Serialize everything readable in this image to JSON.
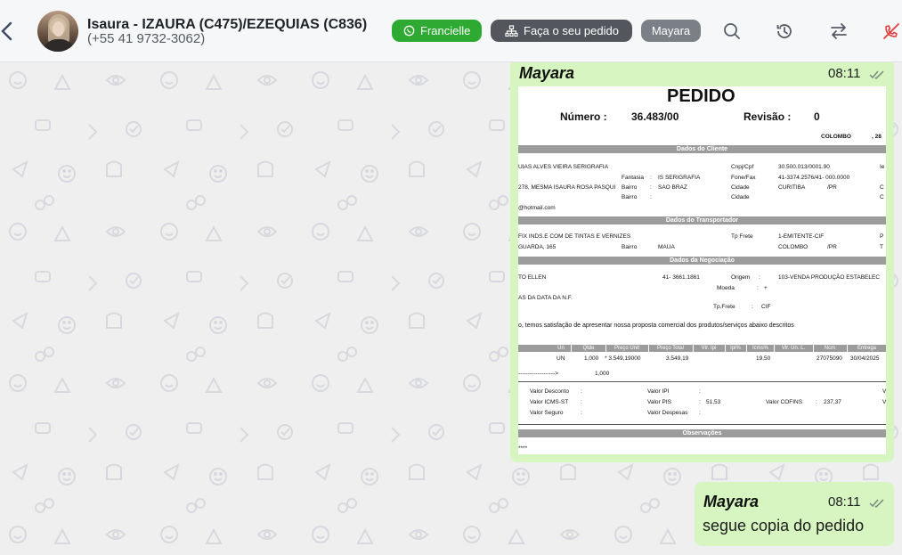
{
  "header": {
    "contact_name": "Isaura - IZAURA (C475)/EZEQUIAS (C836)",
    "contact_phone": "(+55 41 9732-3062)",
    "tags": [
      {
        "label": "Francielle",
        "icon": "whatsapp-icon",
        "color": "#2eaa33"
      },
      {
        "label": "Faça o seu pedido",
        "icon": "sitemap-icon",
        "color": "#53575d"
      },
      {
        "label": "Mayara",
        "color": "#7b8087"
      }
    ],
    "icons": [
      "back-chevron-icon",
      "search-icon",
      "history-icon",
      "transfer-icon",
      "close-chat-icon"
    ]
  },
  "messages": [
    {
      "sender": "Mayara",
      "time": "08:11",
      "type": "image",
      "document": {
        "title": "PEDIDO",
        "numero_label": "Número :",
        "numero_value": "36.483/00",
        "revisao_label": "Revisão :",
        "revisao_value": "0",
        "city_date": "COLOMBO",
        "city_date_suffix": ", 28",
        "section_cliente": "Dados do Cliente",
        "cliente_name": "UIAS ALVES VIEIRA SERIGRAFIA",
        "cnpj_label": "Cnpj/Cpf",
        "cnpj_value": "30.500.013/0001.90",
        "ie_label": "Ie",
        "fantasia_label": "Fantasia",
        "fantasia_value": "IS SERIGRAFIA",
        "fone_label": "Fone/Fax",
        "fone_value": "41-3374.2576/41- 000.0000",
        "address": "278, MESMA ISAURA ROSA PASQUI",
        "bairro_label": "Bairro",
        "bairro_value": "SAO BRAZ",
        "cidade_label": "Cidade",
        "cidade_value": "CURITIBA",
        "uf_value": "/PR",
        "c_label": "C",
        "email": "@hotmail.com",
        "section_transportador": "Dados do Transportador",
        "transp_name": "FIX INDS.E COM DE TINTAS E VERNIZES",
        "tp_frete_label": "Tp Frete",
        "tp_frete_value": "1-EMITENTE-CIF",
        "p_label": "P",
        "transp_address": "GUARDA, 165",
        "transp_bairro_value": "MAUA",
        "transp_cidade_value": "COLOMBO",
        "t_label": "T",
        "section_negociacao": "Dados da Negociação",
        "neg_contact": "TO ELLEN",
        "neg_phone": "41- 3661.1861",
        "origem_label": "Origem",
        "origem_value": "103-VENDA PRODUÇÃO ESTABELEC",
        "moeda_label": "Moeda",
        "moeda_value": "+",
        "prazo_text": "AS DA DATA DA N.F.",
        "tp_frete2_label": "Tp.Frete",
        "tp_frete2_value": "CIF",
        "proposal_text": "o, temos satisfação de apresentar nossa proposta comercial dos produtos/serviços abaixo descritos",
        "table_headers": [
          "Un",
          "Qtde",
          "Preço Unit",
          "Preço Total",
          "Vlr. Ipi",
          "Ipi%",
          "Icms%",
          "Vlr. Un. L.",
          "Ncm",
          "Entrega"
        ],
        "table_row": [
          "UN",
          "1,000",
          "* 3.549,19000",
          "3.549,19",
          "19,50",
          "27075090",
          "30/04/2025"
        ],
        "arrow_text": "------------------->",
        "total_qtde": "1,000",
        "valor_desconto_label": "Valor Desconto",
        "valor_ipi_label": "Valor IPI",
        "valor_icms_st_label": "Valor ICMS-ST",
        "valor_pis_label": "Valor PIS",
        "valor_pis_value": "51,53",
        "valor_cofins_label": "Valor COFINS",
        "valor_cofins_value": "237,37",
        "valor_seguro_label": "Valor Seguro",
        "valor_despesas_label": "Valor Despesas",
        "v_label": "V",
        "colon": ":",
        "section_observacoes": "Observações",
        "obs_text": "****"
      }
    },
    {
      "sender": "Mayara",
      "time": "08:11",
      "type": "text",
      "text": "segue copia do pedido"
    }
  ],
  "colors": {
    "bubble": "#d6f5c1",
    "chat_bg": "#efefef",
    "header_bg": "#f6f7f9",
    "danger_icon": "#e0413f"
  }
}
